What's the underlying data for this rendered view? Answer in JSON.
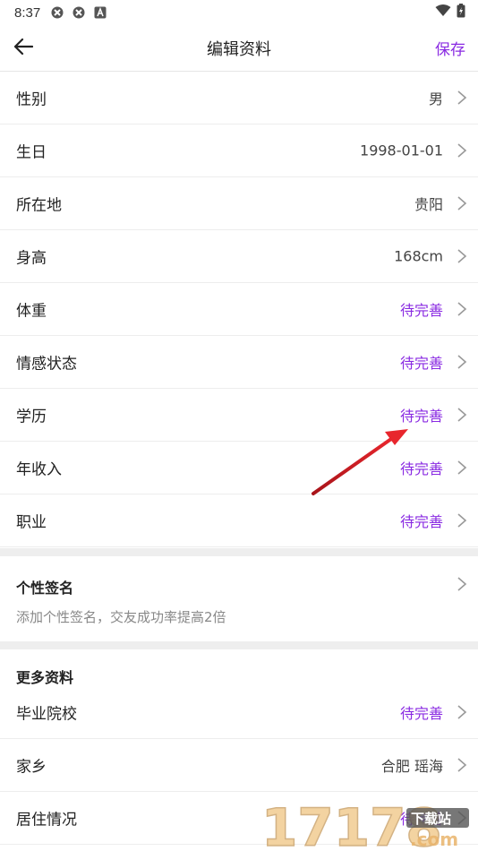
{
  "status_bar": {
    "time": "8:37"
  },
  "nav": {
    "title": "编辑资料",
    "save_label": "保存",
    "back_icon": "arrow-left-icon"
  },
  "colors": {
    "accent": "#8a2be2",
    "pending": "#8a2be2",
    "divider": "#ededed",
    "section_gap": "#eeeeee",
    "annotation_arrow": "#d9232a"
  },
  "basic_rows": [
    {
      "label": "性别",
      "value": "男",
      "pending": false
    },
    {
      "label": "生日",
      "value": "1998-01-01",
      "pending": false
    },
    {
      "label": "所在地",
      "value": "贵阳",
      "pending": false
    },
    {
      "label": "身高",
      "value": "168cm",
      "pending": false
    },
    {
      "label": "体重",
      "value": "待完善",
      "pending": true
    },
    {
      "label": "情感状态",
      "value": "待完善",
      "pending": true
    },
    {
      "label": "学历",
      "value": "待完善",
      "pending": true
    },
    {
      "label": "年收入",
      "value": "待完善",
      "pending": true
    },
    {
      "label": "职业",
      "value": "待完善",
      "pending": true
    }
  ],
  "signature": {
    "title": "个性签名",
    "hint": "添加个性签名，交友成功率提高2倍"
  },
  "more": {
    "title": "更多资料",
    "rows": [
      {
        "label": "毕业院校",
        "value": "待完善",
        "pending": true
      },
      {
        "label": "家乡",
        "value": "合肥 瑶海",
        "pending": false
      },
      {
        "label": "居住情况",
        "value": "待完善",
        "pending": true
      }
    ]
  },
  "watermark": {
    "text": "17178.com",
    "badge": "下载站"
  }
}
